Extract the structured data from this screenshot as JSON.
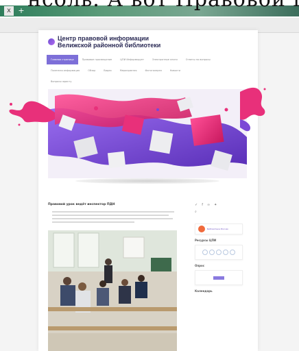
{
  "top_strip": {
    "caption": "нсоль. А  вот Правовой  путь",
    "close_glyph": "x",
    "plus_glyph": "+"
  },
  "header": {
    "title_line1": "Центр правовой информации",
    "title_line2": "Велижской районной библиотеки"
  },
  "nav": {
    "row1": [
      "Главная страница",
      "Правовое просвещение",
      "ЦПИ Информирует",
      "Электронные книги",
      "Ответы на вопросы"
    ],
    "row2": [
      "Полезная информация",
      "Обзор",
      "Видео",
      "Мероприятия",
      "Фотогалерея",
      "Новости"
    ],
    "row3": [
      "Вопросы юристу"
    ]
  },
  "article": {
    "title": "Правовой урок ведёт инспектор ПДН"
  },
  "sidebar": {
    "social_icons": [
      "vk-icon",
      "facebook-icon",
      "ok-icon",
      "twitter-icon"
    ],
    "search_glyph": "⌕",
    "promo_text": "Библиотека России",
    "widget2_title": "Ресурсы ЦПИ",
    "widget3_title": "Опрос",
    "widget4_title": "Календарь"
  },
  "colors": {
    "nav_active": "#7d6fd8",
    "title": "#2a2a55",
    "splash_pink": "#e8307a",
    "splash_purple": "#7b48d6"
  }
}
